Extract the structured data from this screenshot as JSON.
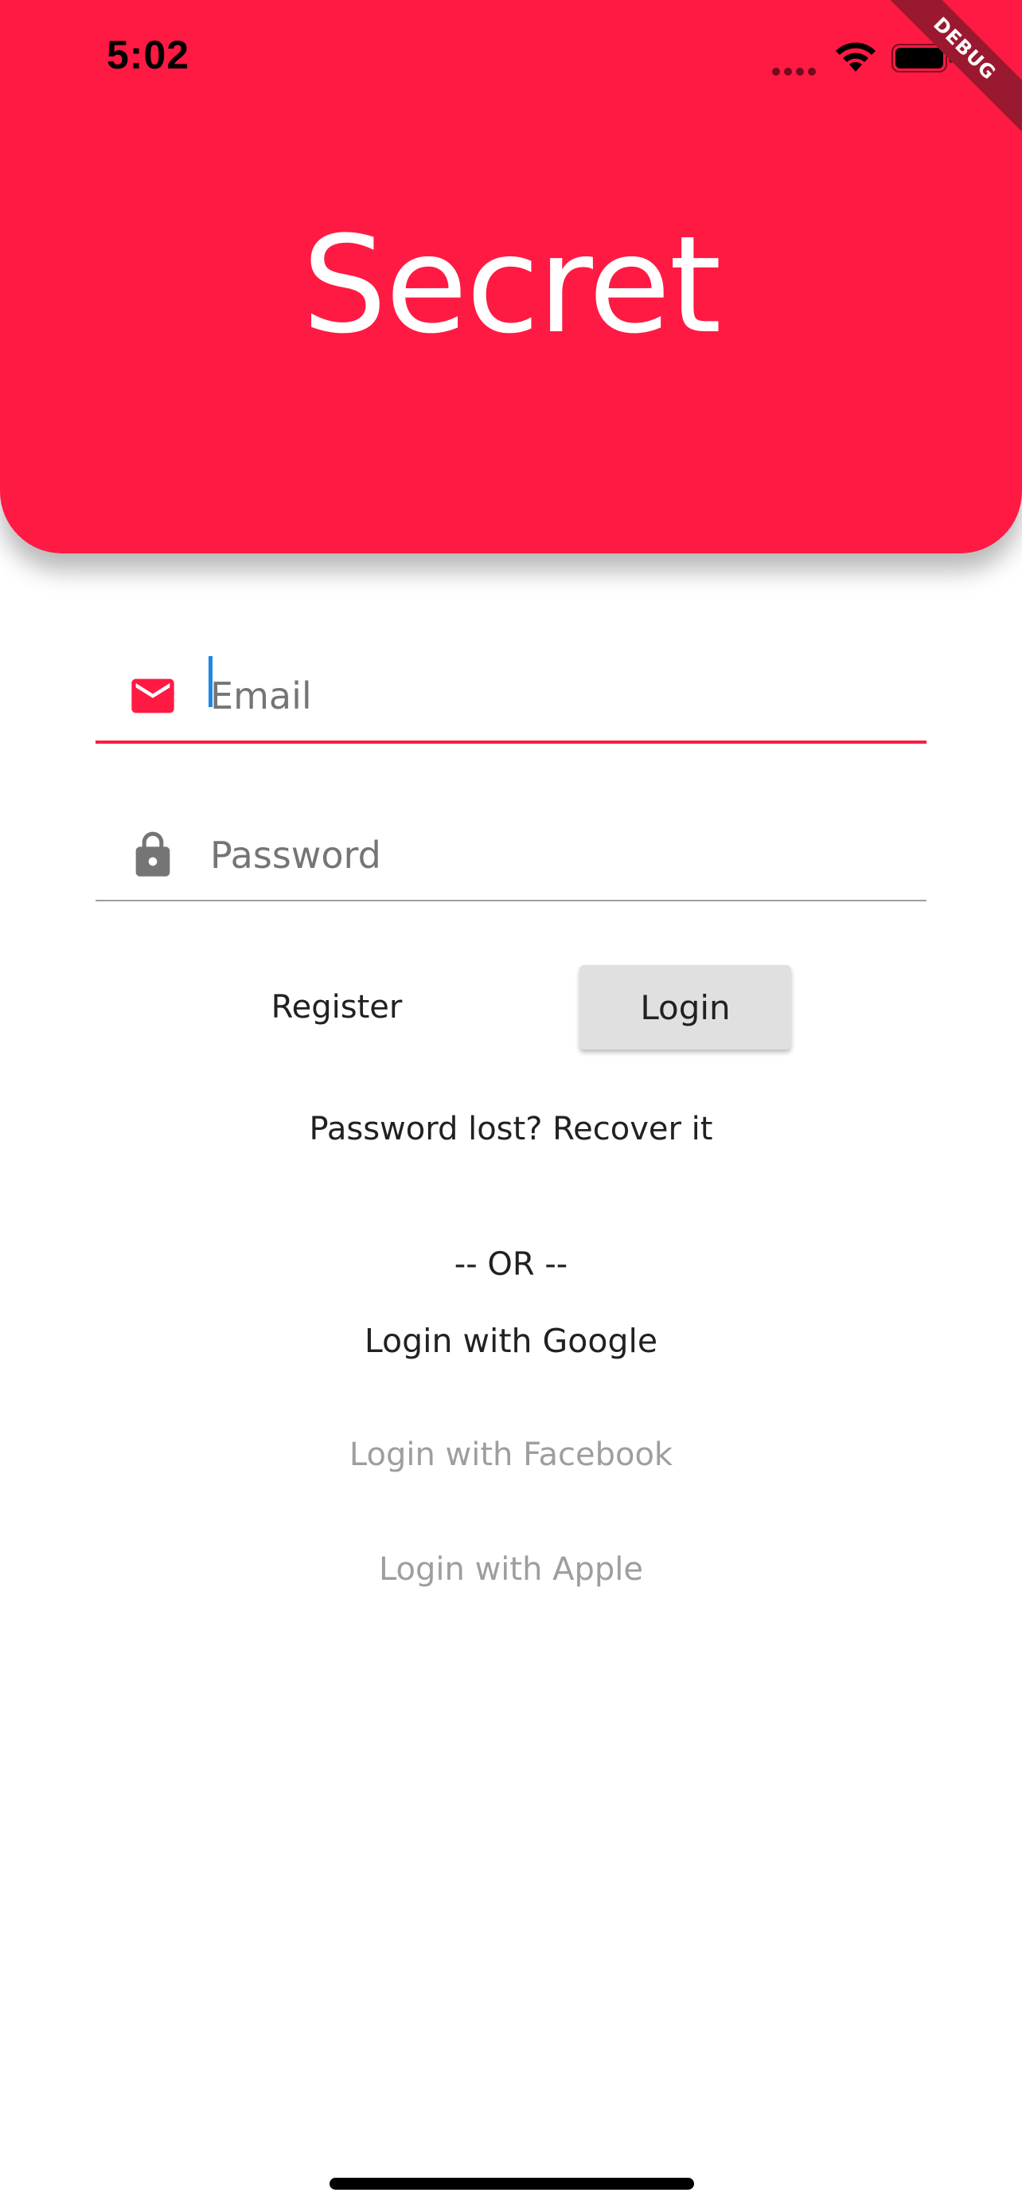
{
  "status_bar": {
    "time": "5:02",
    "signal_icon": "signal-dots-icon",
    "wifi_icon": "wifi-icon",
    "battery_icon": "battery-icon"
  },
  "debug_banner": "DEBUG",
  "header": {
    "title": "Secret",
    "background_color": "#ff1a43"
  },
  "form": {
    "email": {
      "icon": "mail-icon",
      "placeholder": "Email",
      "value": ""
    },
    "password": {
      "icon": "lock-icon",
      "placeholder": "Password",
      "value": ""
    }
  },
  "actions": {
    "register_label": "Register",
    "login_label": "Login",
    "recover_label": "Password lost? Recover it"
  },
  "social": {
    "divider_label": "-- OR --",
    "google_label": "Login with Google",
    "facebook_label": "Login with Facebook",
    "apple_label": "Login with Apple"
  },
  "colors": {
    "accent": "#ff1a43",
    "disabled_text": "#9e9e9e",
    "caret": "#1e88e5"
  }
}
